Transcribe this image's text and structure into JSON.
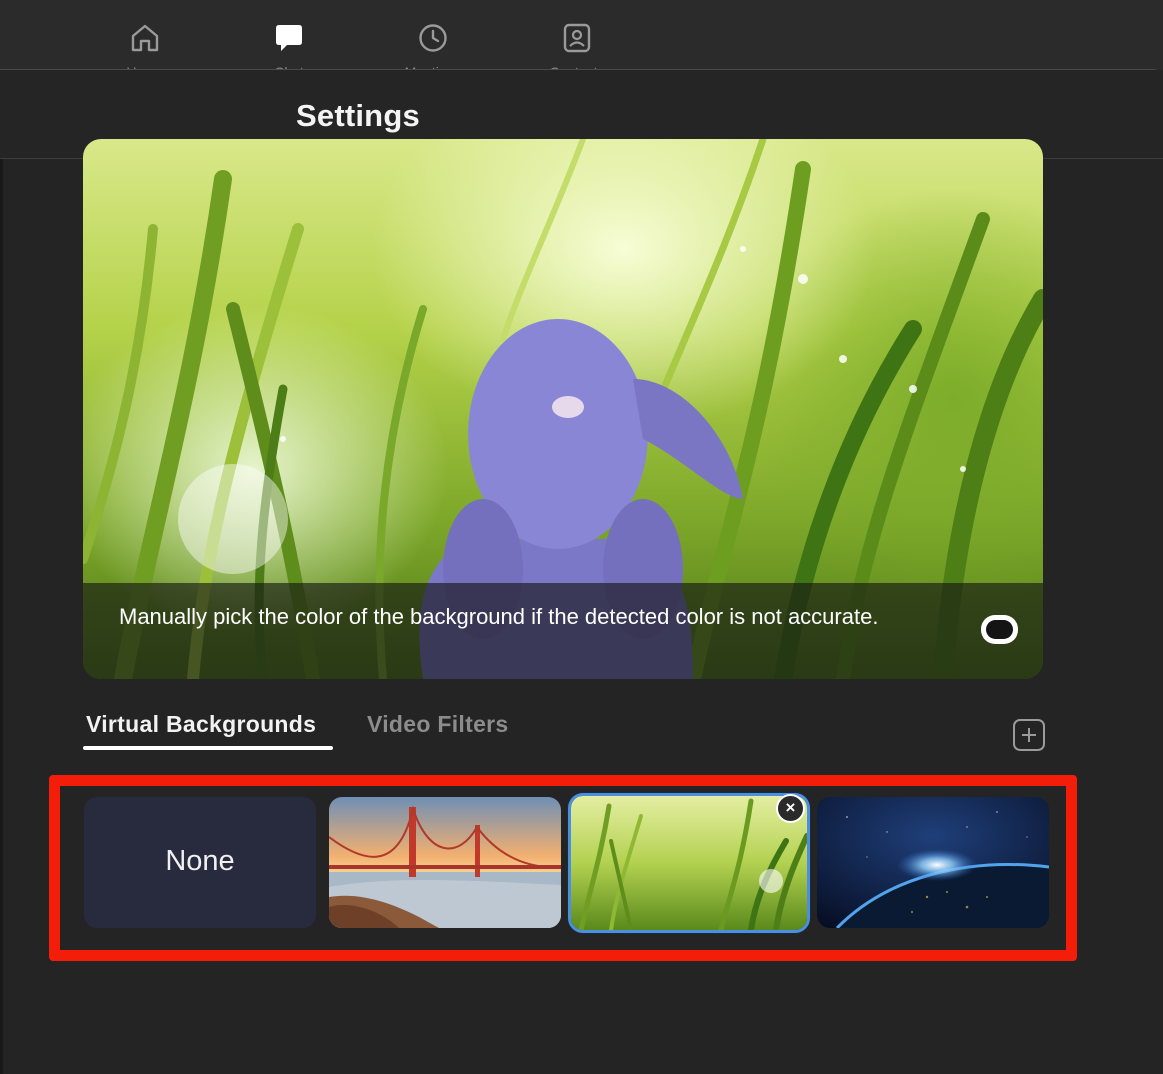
{
  "nav": {
    "items": [
      {
        "id": "home",
        "label": "Home",
        "icon": "home-icon"
      },
      {
        "id": "chat",
        "label": "Chat",
        "icon": "chat-icon"
      },
      {
        "id": "meetings",
        "label": "Meetings",
        "icon": "clock-icon"
      },
      {
        "id": "contacts",
        "label": "Contacts",
        "icon": "contacts-icon"
      }
    ]
  },
  "settings": {
    "title": "Settings"
  },
  "preview": {
    "caption": "Manually pick the color of the background if the detected color is not accurate."
  },
  "tabs": {
    "virtual_backgrounds": "Virtual Backgrounds",
    "video_filters": "Video Filters",
    "active": "Virtual Backgrounds"
  },
  "backgrounds": {
    "none_label": "None",
    "items": [
      {
        "id": "none",
        "selected": false
      },
      {
        "id": "golden-gate-bridge",
        "selected": false
      },
      {
        "id": "grass",
        "selected": true
      },
      {
        "id": "earth-from-space",
        "selected": false
      }
    ]
  },
  "colors": {
    "accent_selected": "#4b8fe0",
    "highlight_frame": "#f41d0a",
    "background": "#232323"
  }
}
